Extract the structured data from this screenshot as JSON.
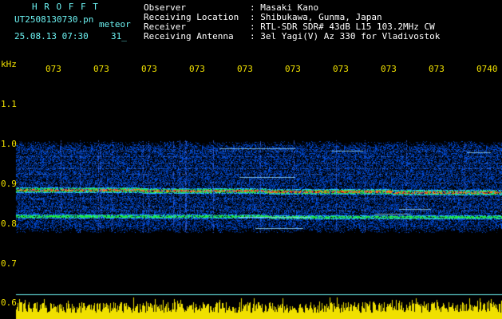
{
  "header": {
    "station": "H R O F F T",
    "filename": "UT2508130730.pn",
    "type_label": "meteor",
    "datetime": "25.08.13 07:30",
    "count": "31_",
    "info": [
      {
        "key": "Observer",
        "value": ": Masaki Kano"
      },
      {
        "key": "Receiving Location",
        "value": ": Shibukawa, Gunma, Japan"
      },
      {
        "key": "Receiver",
        "value": ": RTL-SDR SDR# 43dB L15 103.2MHz CW"
      },
      {
        "key": "Receiving Antenna",
        "value": ": 3el Yagi(V) Az 330 for Vladivostok"
      }
    ]
  },
  "spectrogram": {
    "unit_label": "kHz",
    "y_ticks": [
      "1.1",
      "1.0",
      "0.9",
      "0.8",
      "0.7",
      "0.6"
    ],
    "time_ticks": [
      "073",
      "073",
      "073",
      "073",
      "073",
      "073",
      "073",
      "073",
      "073",
      "0740"
    ]
  },
  "colors": {
    "background": "#000000",
    "header_cyan": "#6cf2f2",
    "label_yellow": "#f0e000",
    "signal_blue": "#1a3cff",
    "signal_red": "#ff2020"
  }
}
